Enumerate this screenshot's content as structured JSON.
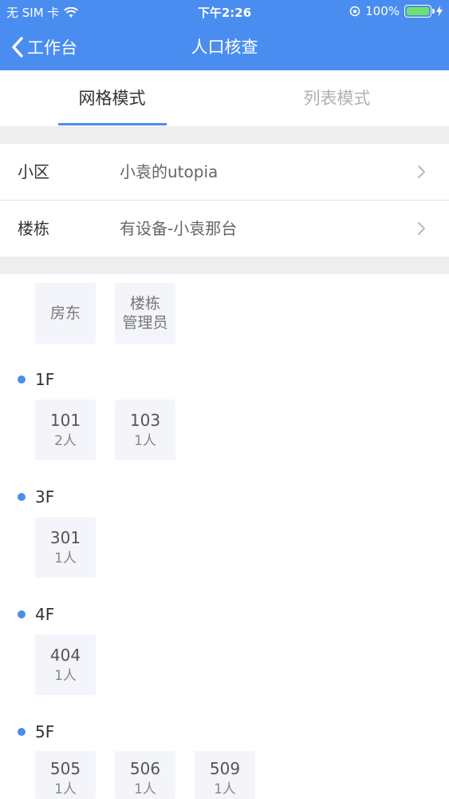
{
  "status_bar": {
    "carrier": "无 SIM 卡",
    "time": "下午2:26",
    "battery": "100%"
  },
  "nav": {
    "back_label": "工作台",
    "title": "人口核查"
  },
  "tabs": [
    {
      "label": "网格模式",
      "active": true
    },
    {
      "label": "列表模式",
      "active": false
    }
  ],
  "selectors": {
    "community_label": "小区",
    "community_value": "小袁的utopia",
    "building_label": "楼栋",
    "building_value": "有设备-小袁那台"
  },
  "roles": {
    "landlord": "房东",
    "manager_line1": "楼栋",
    "manager_line2": "管理员"
  },
  "floors": [
    {
      "label": "1F",
      "units": [
        {
          "room": "101",
          "count": "2人"
        },
        {
          "room": "103",
          "count": "1人"
        }
      ]
    },
    {
      "label": "3F",
      "units": [
        {
          "room": "301",
          "count": "1人"
        }
      ]
    },
    {
      "label": "4F",
      "units": [
        {
          "room": "404",
          "count": "1人"
        }
      ]
    },
    {
      "label": "5F",
      "units": [
        {
          "room": "505",
          "count": "1人"
        },
        {
          "room": "506",
          "count": "1人"
        },
        {
          "room": "509",
          "count": "1人"
        }
      ]
    }
  ],
  "colors": {
    "accent": "#4a8df0",
    "tile_bg": "#f3f5fa",
    "separator": "#eeeef0"
  }
}
